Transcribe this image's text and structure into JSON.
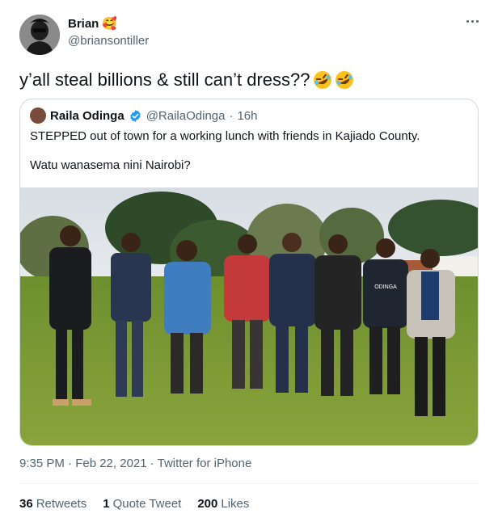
{
  "tweet": {
    "author_name": "Brian",
    "author_emoji": "🥰",
    "author_handle": "@briansontiller",
    "text": "y’all steal billions & still can’t dress??",
    "text_emoji": "🤣🤣",
    "timestamp": "9:35 PM · Feb 22, 2021",
    "source": "Twitter for iPhone",
    "more_icon": "more-dots-icon"
  },
  "quote": {
    "author_name": "Raila Odinga",
    "author_handle": "@RailaOdinga",
    "time": "16h",
    "verified_icon": "verified-badge-icon",
    "line1": "STEPPED out of town for a working lunch with friends in Kajiado County.",
    "line2": "Watu wanasema nini Nairobi?",
    "photo_caption_on_sweater": "ODINGA"
  },
  "stats": {
    "retweets_count": "36",
    "retweets_label": "Retweets",
    "quotes_count": "1",
    "quotes_label": "Quote Tweet",
    "likes_count": "200",
    "likes_label": "Likes"
  },
  "colors": {
    "text_primary": "#0f1419",
    "text_secondary": "#536471",
    "border": "#cfd9de",
    "verified_blue": "#1d9bf0"
  }
}
